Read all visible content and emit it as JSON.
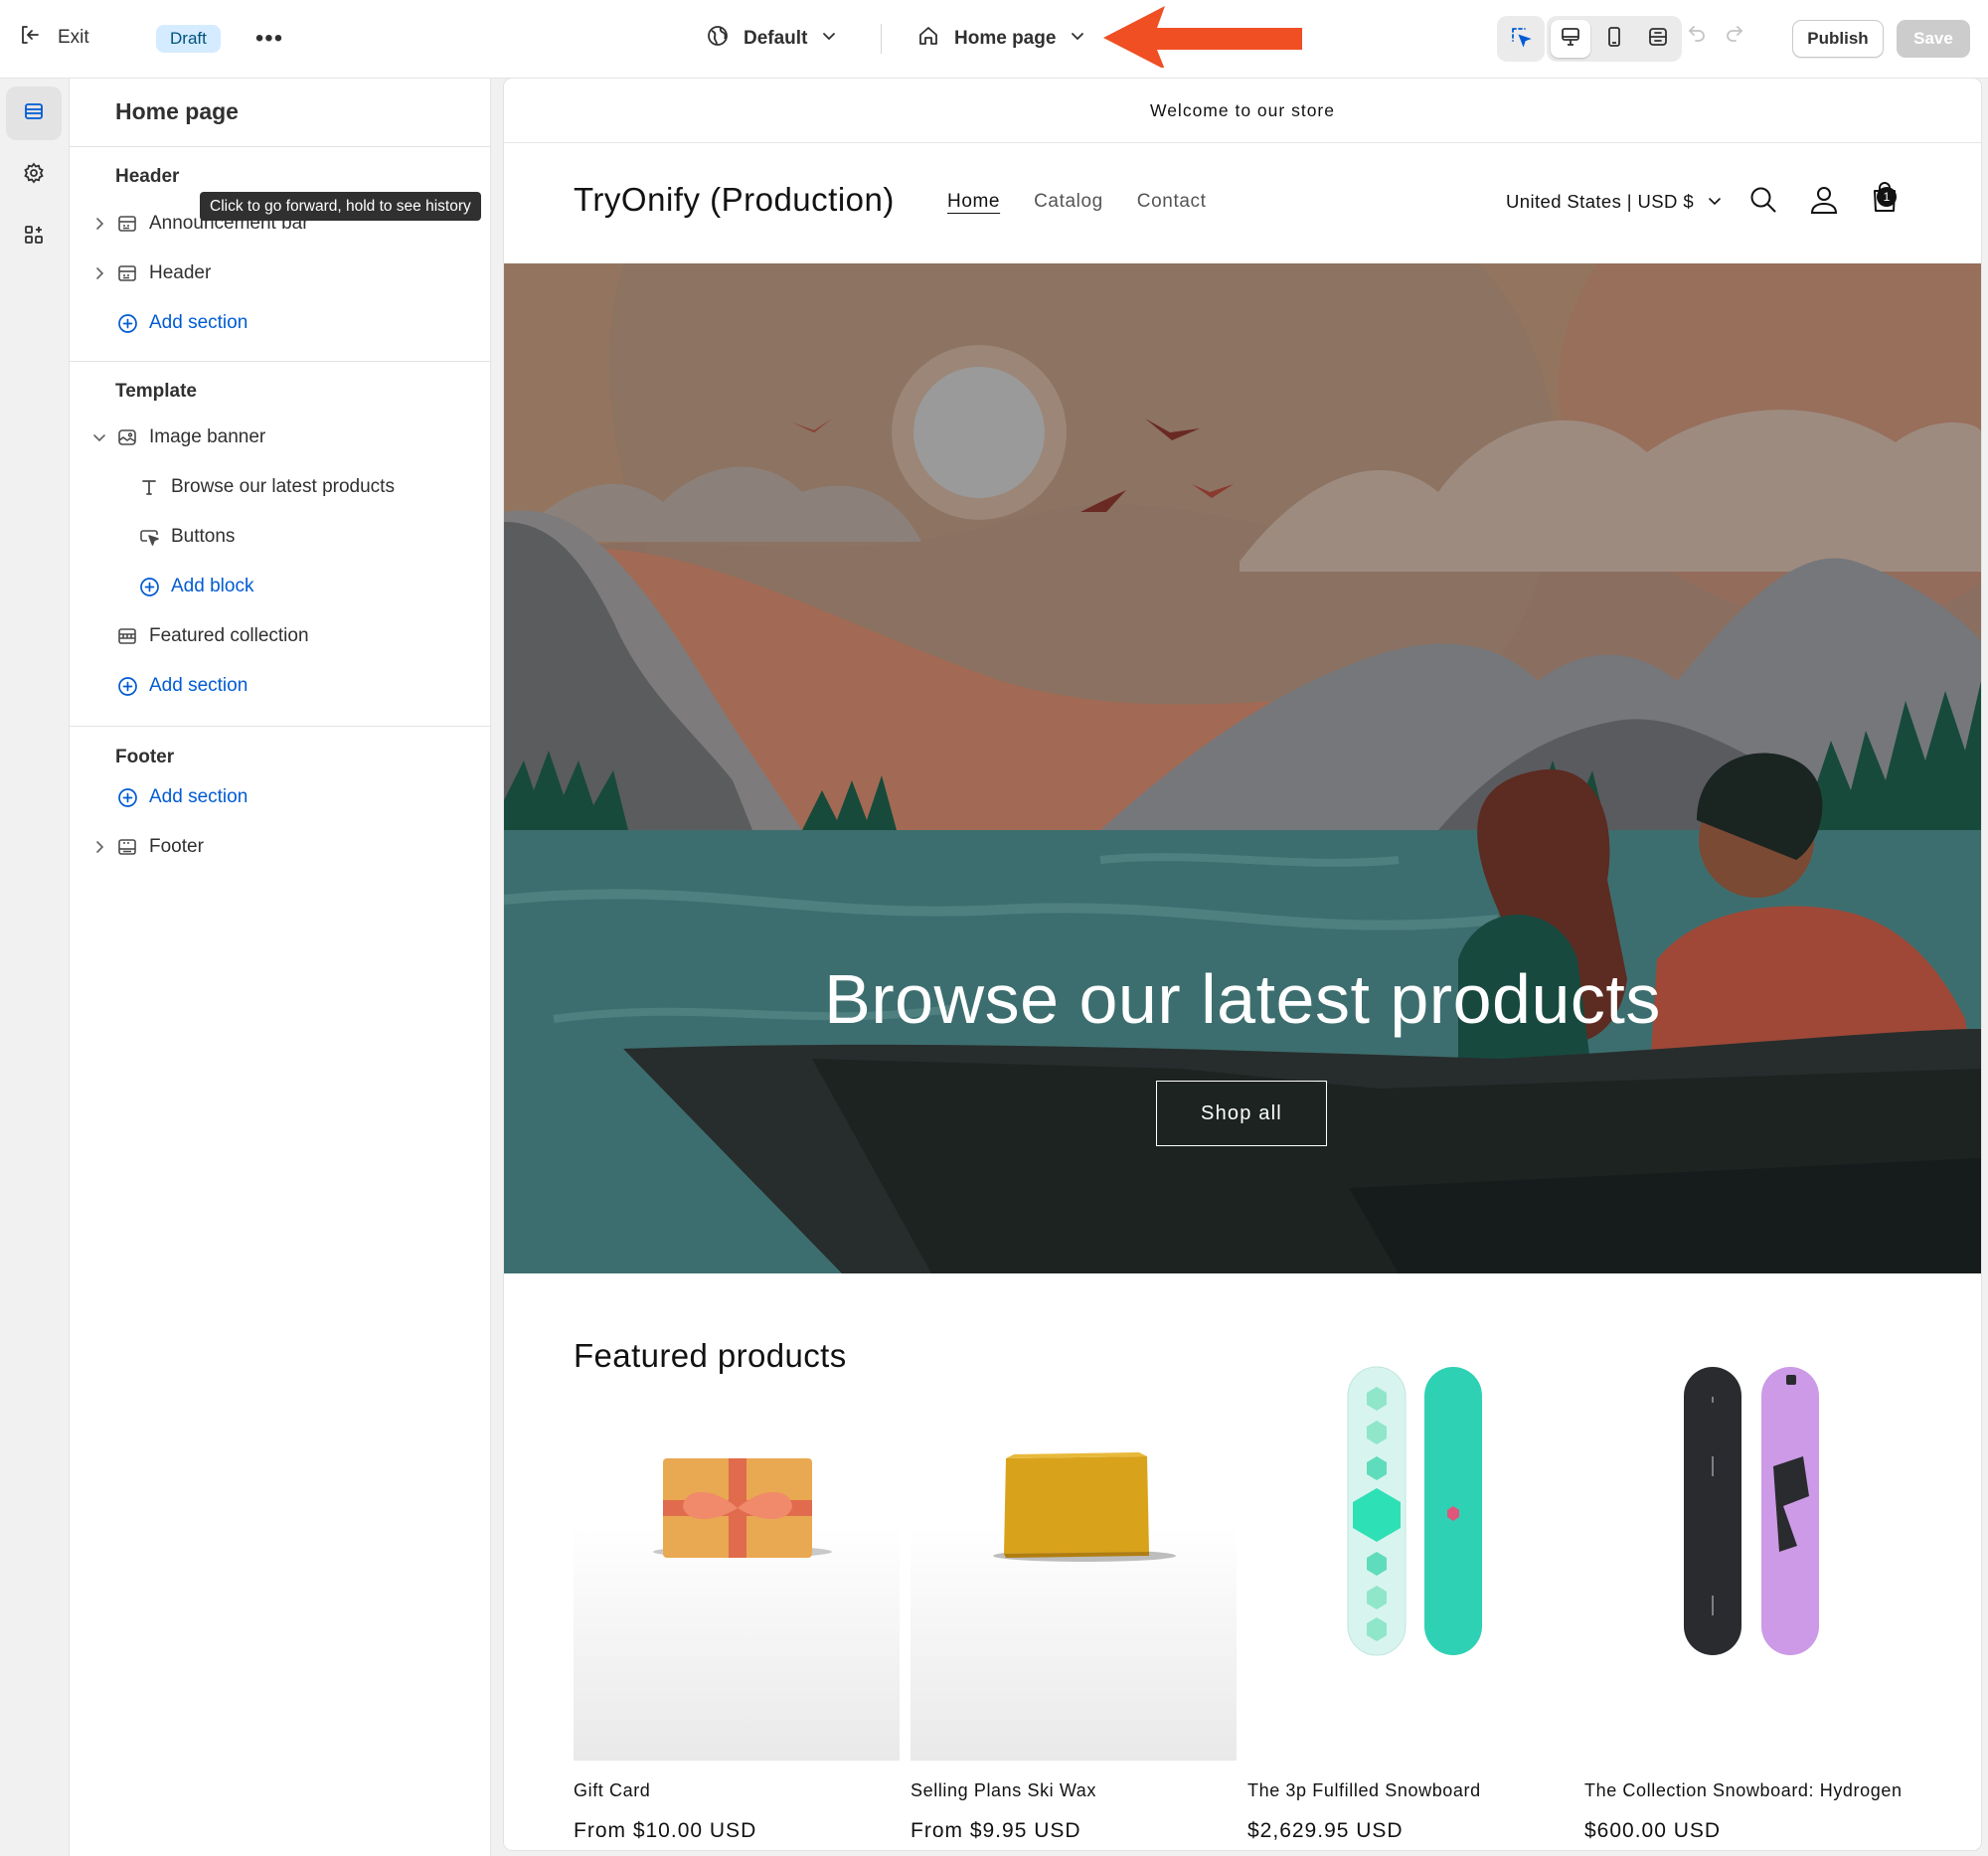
{
  "topbar": {
    "exit_label": "Exit",
    "status_badge": "Draft",
    "more_label": "•••",
    "theme_name": "Default",
    "page_name": "Home page",
    "publish_label": "Publish",
    "save_label": "Save"
  },
  "tooltip": "Click to go forward, hold to see history",
  "sidebar": {
    "title": "Home page",
    "header_group": "Header",
    "header_items": [
      "Announcement bar",
      "Header"
    ],
    "header_add": "Add section",
    "template_group": "Template",
    "image_banner": "Image banner",
    "banner_blocks": [
      "Browse our latest products",
      "Buttons"
    ],
    "add_block": "Add block",
    "featured_collection": "Featured collection",
    "template_add": "Add section",
    "footer_group": "Footer",
    "footer_add": "Add section",
    "footer_item": "Footer"
  },
  "store": {
    "announcement": "Welcome to our store",
    "name": "TryOnify (Production)",
    "nav": [
      "Home",
      "Catalog",
      "Contact"
    ],
    "country": "United States | USD $",
    "cart_count": "1",
    "banner_heading": "Browse our latest products",
    "banner_button": "Shop all",
    "featured_title": "Featured products",
    "products": [
      {
        "name": "Gift Card",
        "price": "From $10.00 USD"
      },
      {
        "name": "Selling Plans Ski Wax",
        "price": "From $9.95 USD"
      },
      {
        "name": "The 3p Fulfilled Snowboard",
        "price": "$2,629.95 USD"
      },
      {
        "name": "The Collection Snowboard: Hydrogen",
        "price": "$600.00 USD"
      }
    ]
  },
  "colors": {
    "accent_blue": "#005bd3",
    "arrow_red": "#f04e23",
    "badge_bg": "#d5ebff"
  },
  "icons": [
    "exit-icon",
    "globe-icon",
    "home-icon",
    "chevron-down-icon",
    "select-cursor-icon",
    "desktop-icon",
    "mobile-icon",
    "fullscreen-icon",
    "undo-icon",
    "redo-icon",
    "sections-icon",
    "settings-gear-icon",
    "apps-icon",
    "search-icon",
    "account-icon",
    "cart-icon"
  ]
}
